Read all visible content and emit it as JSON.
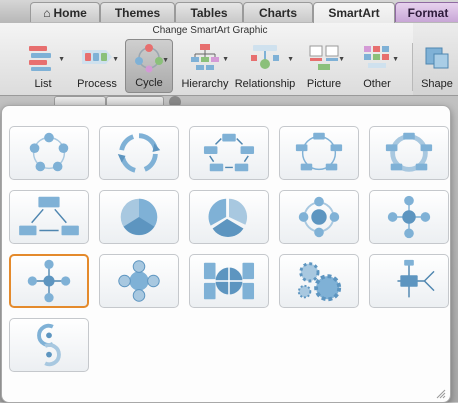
{
  "tabs": [
    {
      "label": "Home",
      "icon": "home-icon",
      "active": false
    },
    {
      "label": "Themes",
      "active": false
    },
    {
      "label": "Tables",
      "active": false
    },
    {
      "label": "Charts",
      "active": false
    },
    {
      "label": "SmartArt",
      "active": true
    },
    {
      "label": "Format",
      "active": false
    }
  ],
  "ribbon": {
    "group_title": "Change SmartArt Graphic",
    "buttons": [
      {
        "label": "List",
        "icon": "list-layout-icon"
      },
      {
        "label": "Process",
        "icon": "process-layout-icon"
      },
      {
        "label": "Cycle",
        "icon": "cycle-layout-icon",
        "selected": true
      },
      {
        "label": "Hierarchy",
        "icon": "hierarchy-layout-icon"
      },
      {
        "label": "Relationship",
        "icon": "relationship-layout-icon"
      },
      {
        "label": "Picture",
        "icon": "picture-layout-icon"
      },
      {
        "label": "Other",
        "icon": "other-layout-icon"
      },
      {
        "label": "Shape",
        "icon": "shape-icon"
      }
    ]
  },
  "gallery": {
    "category": "Cycle",
    "selected_index": 10,
    "layouts": [
      "basic-cycle",
      "arrow-cycle",
      "text-cycle",
      "block-cycle",
      "continuous-cycle",
      "segmented-cycle",
      "basic-pie",
      "cycle-pie",
      "radial-cycle",
      "basic-radial",
      "diverging-radial",
      "radial-venn",
      "cycle-matrix",
      "gear",
      "radial-cluster",
      "circle-arrow-process"
    ]
  },
  "colors": {
    "accent_blue": "#7fb1d6",
    "selection": "#e48a2c",
    "format_tab": "#c8a6d6"
  }
}
